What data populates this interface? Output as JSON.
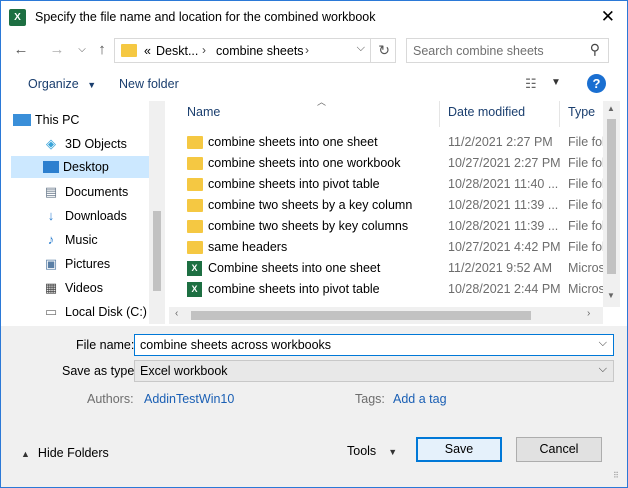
{
  "window": {
    "title": "Specify the file name and location for the combined workbook",
    "app_icon": "X"
  },
  "address": {
    "prefix": "«",
    "crumbs": [
      "Deskt...",
      "combine sheets"
    ],
    "search_placeholder": "Search combine sheets"
  },
  "toolbar": {
    "organize_label": "Organize",
    "new_folder_label": "New folder",
    "help_label": "?"
  },
  "nav_pane": {
    "items": [
      {
        "label": "This PC",
        "icon": "pc-icon"
      },
      {
        "label": "3D Objects",
        "icon": "cube-icon"
      },
      {
        "label": "Desktop",
        "icon": "desktop-icon",
        "selected": true
      },
      {
        "label": "Documents",
        "icon": "documents-icon"
      },
      {
        "label": "Downloads",
        "icon": "download-arrow-icon"
      },
      {
        "label": "Music",
        "icon": "music-note-icon"
      },
      {
        "label": "Pictures",
        "icon": "pictures-icon"
      },
      {
        "label": "Videos",
        "icon": "film-icon"
      },
      {
        "label": "Local Disk (C:)",
        "icon": "disk-icon"
      }
    ]
  },
  "file_list": {
    "columns": [
      "Name",
      "Date modified",
      "Type"
    ],
    "rows": [
      {
        "name": "combine sheets into one sheet",
        "date": "11/2/2021 2:27 PM",
        "type": "File fol",
        "kind": "folder"
      },
      {
        "name": "combine sheets into one workbook",
        "date": "10/27/2021 2:27 PM",
        "type": "File fol",
        "kind": "folder"
      },
      {
        "name": "combine sheets into pivot table",
        "date": "10/28/2021 11:40 ...",
        "type": "File fol",
        "kind": "folder"
      },
      {
        "name": "combine two sheets by a key column",
        "date": "10/28/2021 11:39 ...",
        "type": "File fol",
        "kind": "folder"
      },
      {
        "name": "combine two sheets by key columns",
        "date": "10/28/2021 11:39 ...",
        "type": "File fol",
        "kind": "folder"
      },
      {
        "name": "same headers",
        "date": "10/27/2021 4:42 PM",
        "type": "File fol",
        "kind": "folder"
      },
      {
        "name": "Combine sheets into one sheet",
        "date": "11/2/2021 9:52 AM",
        "type": "Micros",
        "kind": "xlsx"
      },
      {
        "name": "combine sheets into pivot table",
        "date": "10/28/2021 2:44 PM",
        "type": "Micros",
        "kind": "xlsx"
      }
    ]
  },
  "save_form": {
    "file_name_label": "File name:",
    "file_name_value": "combine sheets across workbooks",
    "save_as_type_label": "Save as type:",
    "save_as_type_value": "Excel workbook",
    "authors_label": "Authors:",
    "authors_value": "AddinTestWin10",
    "tags_label": "Tags:",
    "tags_value": "Add a tag"
  },
  "footer": {
    "hide_folders_label": "Hide Folders",
    "tools_label": "Tools",
    "save_label": "Save",
    "cancel_label": "Cancel"
  },
  "colors": {
    "accent": "#0078d7",
    "selection": "#cce8ff",
    "folder": "#f5c842",
    "excel": "#1d6f42",
    "link": "#1a5fb4"
  }
}
